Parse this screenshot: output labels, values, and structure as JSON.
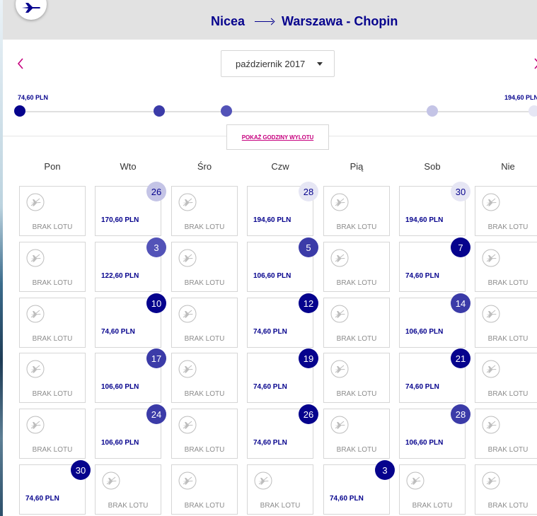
{
  "header": {
    "origin": "Nicea",
    "destination": "Warszawa - Chopin"
  },
  "month_selector": {
    "value": "październik 2017"
  },
  "price_range": {
    "min_label": "74,60 PLN",
    "max_label": "194,60 PLN"
  },
  "colors": {
    "brand": "#06038d",
    "accent": "#c6007e",
    "tier_lowest": "#06038d",
    "tier_low": "#3b3ba8",
    "tier_mid": "#5353b8",
    "tier_high": "#c4c4e6",
    "tier_highest": "#e6e6f4"
  },
  "show_hours_button": "POKAŻ GODZINY WYLOTU",
  "weekdays": [
    "Pon",
    "Wto",
    "Śro",
    "Czw",
    "Pią",
    "Sob",
    "Nie"
  ],
  "no_flight_label": "BRAK LOTU",
  "calendar": [
    [
      null,
      {
        "day": "26",
        "price": "170,60 PLN",
        "tier": "high"
      },
      null,
      {
        "day": "28",
        "price": "194,60 PLN",
        "tier": "highest"
      },
      null,
      {
        "day": "30",
        "price": "194,60 PLN",
        "tier": "highest"
      },
      null
    ],
    [
      null,
      {
        "day": "3",
        "price": "122,60 PLN",
        "tier": "mid"
      },
      null,
      {
        "day": "5",
        "price": "106,60 PLN",
        "tier": "low"
      },
      null,
      {
        "day": "7",
        "price": "74,60 PLN",
        "tier": "lowest"
      },
      null
    ],
    [
      null,
      {
        "day": "10",
        "price": "74,60 PLN",
        "tier": "lowest"
      },
      null,
      {
        "day": "12",
        "price": "74,60 PLN",
        "tier": "lowest"
      },
      null,
      {
        "day": "14",
        "price": "106,60 PLN",
        "tier": "low"
      },
      null
    ],
    [
      null,
      {
        "day": "17",
        "price": "106,60 PLN",
        "tier": "low"
      },
      null,
      {
        "day": "19",
        "price": "74,60 PLN",
        "tier": "lowest"
      },
      null,
      {
        "day": "21",
        "price": "74,60 PLN",
        "tier": "lowest"
      },
      null
    ],
    [
      null,
      {
        "day": "24",
        "price": "106,60 PLN",
        "tier": "low"
      },
      null,
      {
        "day": "26",
        "price": "74,60 PLN",
        "tier": "lowest"
      },
      null,
      {
        "day": "28",
        "price": "106,60 PLN",
        "tier": "low"
      },
      null
    ],
    [
      {
        "day": "30",
        "price": "74,60 PLN",
        "tier": "lowest"
      },
      null,
      null,
      null,
      {
        "day": "3",
        "price": "74,60 PLN",
        "tier": "lowest"
      },
      null,
      null
    ]
  ]
}
